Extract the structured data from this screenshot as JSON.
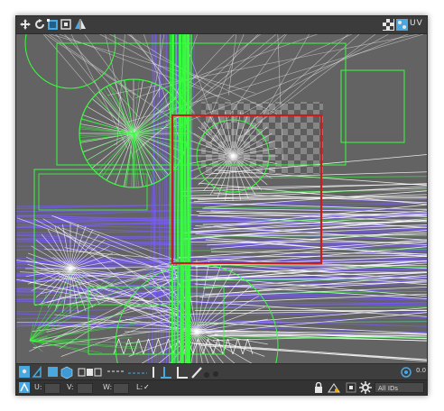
{
  "toolbar": {
    "move_icon": "move-arrows-icon",
    "rotate_icon": "rotate-icon",
    "freeform_icon": "freeform-icon",
    "scale_icon": "scale-icon",
    "mirror_icon": "mirror-icon",
    "checker_icon": "checker-map-icon",
    "uv_label": "UV"
  },
  "status": {
    "u_label": "U:",
    "v_label": "V:",
    "w_label": "W:",
    "l_label": "L:",
    "l_checkbox": "✓",
    "ids_select": "All IDs",
    "zoom_readout": "0.0"
  },
  "colors": {
    "viewport_bg": "#636363",
    "uv_edges": "#39ff3f",
    "mesh_edges": "#ffffff",
    "seam_edges": "#7a5cff",
    "uv_tile_border": "#cc1d1d",
    "toolbar_bg": "#3c3c3c",
    "accent": "#4aa8e0"
  }
}
